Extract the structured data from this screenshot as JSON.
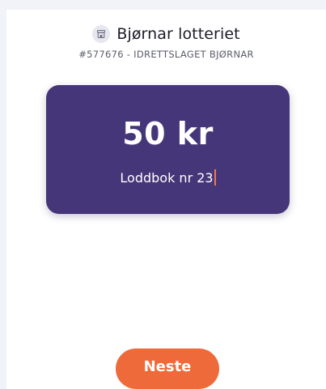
{
  "header": {
    "icon": "shop-icon",
    "title": "Bjørnar lotteriet",
    "subtitle": "#577676 - IDRETTSLAGET BJØRNAR"
  },
  "card": {
    "amount": "50 kr",
    "book_label": "Loddbok nr 23",
    "background_color": "#45367a"
  },
  "footer": {
    "next_label": "Neste",
    "button_color": "#ef6a3a"
  }
}
